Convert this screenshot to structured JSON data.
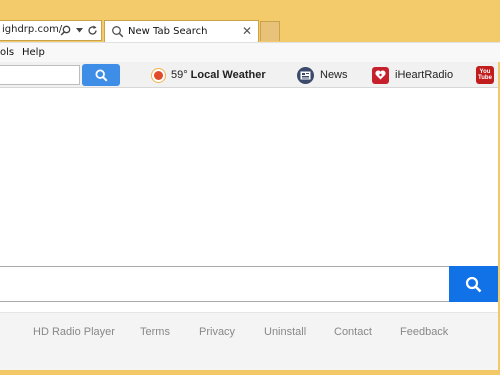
{
  "browser": {
    "address_text": "ighdrp.com/",
    "tab_label": "New Tab Search",
    "tab_close": "✕",
    "menu": [
      "ols",
      "Help"
    ]
  },
  "toolbar": {
    "weather_temp": "59°",
    "weather_label": "Local Weather",
    "news_label": "News",
    "iheart_label": "iHeartRadio",
    "youtube_text": "You Tube"
  },
  "footer": {
    "links": [
      "HD Radio Player",
      "Terms",
      "Privacy",
      "Uninstall",
      "Contact",
      "Feedback"
    ]
  },
  "colors": {
    "chrome": "#f3cb6b",
    "search_button": "#1172e8",
    "toolbar_button": "#3e8ee8"
  }
}
